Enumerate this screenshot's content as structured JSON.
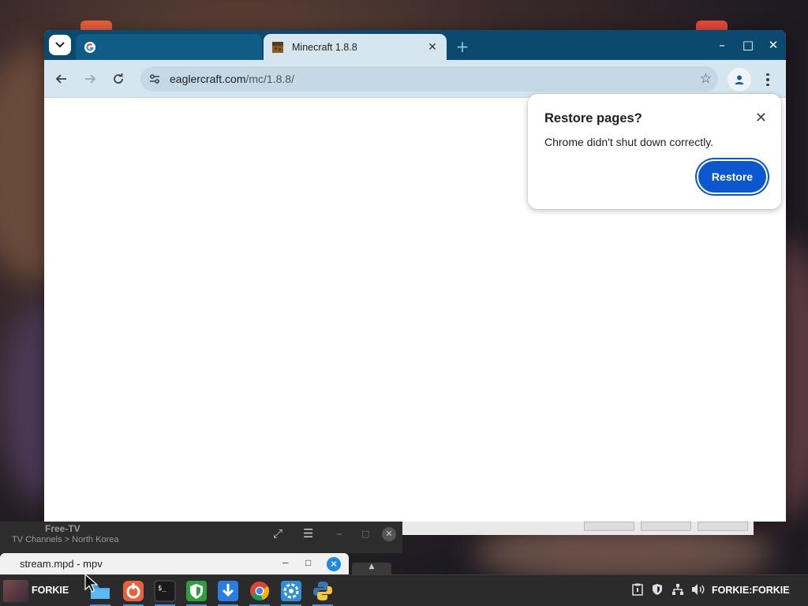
{
  "colors": {
    "tabstrip": "#0b4a6e",
    "active_tab": "#d5e6f1",
    "restore_button": "#0b57d0",
    "taskbar": "#2b2b2b"
  },
  "browser": {
    "tabs": [
      {
        "title": "",
        "favicon": "google-icon",
        "active": false
      },
      {
        "title": "Minecraft 1.8.8",
        "favicon": "minecraft-block-icon",
        "active": true
      }
    ],
    "url": {
      "host": "eaglercraft.com",
      "path": "/mc/1.8.8/"
    },
    "window_controls": {
      "minimize": "–",
      "maximize": "□",
      "close": "✕"
    }
  },
  "restore_dialog": {
    "title": "Restore pages?",
    "message": "Chrome didn't shut down correctly.",
    "button": "Restore",
    "close_glyph": "✕"
  },
  "freetv": {
    "title": "Free-TV",
    "breadcrumb": "TV Channels > North Korea"
  },
  "mpv": {
    "title": "stream.mpd - mpv",
    "controls": {
      "minimize": "–",
      "maximize": "□",
      "close": "✕"
    }
  },
  "taskbar": {
    "user": "FORKIE",
    "apps": [
      "files-icon",
      "app-store-icon",
      "terminal-icon",
      "vpn-shield-icon",
      "download-icon",
      "chrome-icon",
      "settings-gear-icon",
      "python-icon"
    ],
    "tray_icons": [
      "clipboard-icon",
      "shield-icon",
      "network-icon",
      "volume-icon"
    ],
    "session_label": "FORKIE:FORKIE"
  }
}
